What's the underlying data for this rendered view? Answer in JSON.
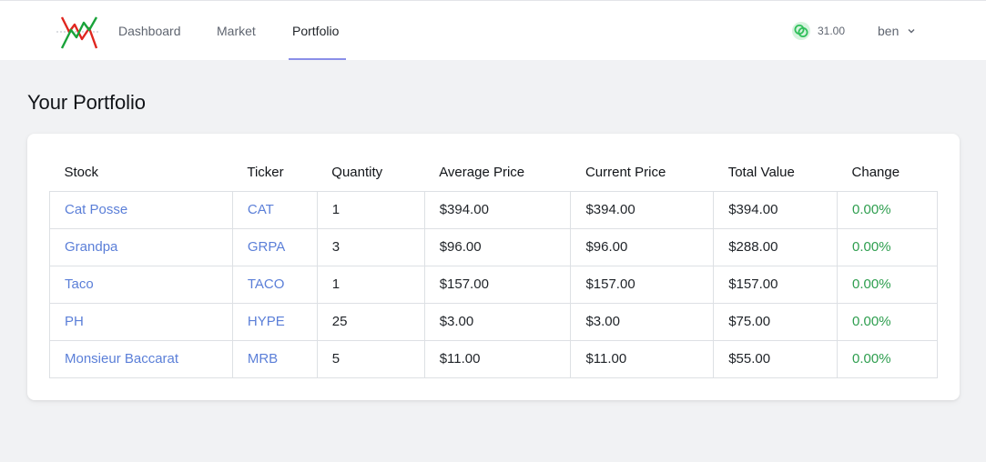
{
  "nav": {
    "items": [
      {
        "label": "Dashboard",
        "active": false
      },
      {
        "label": "Market",
        "active": false
      },
      {
        "label": "Portfolio",
        "active": true
      }
    ],
    "balance": "31.00",
    "user": "ben",
    "accent": "#8a8fe8"
  },
  "page": {
    "title": "Your Portfolio"
  },
  "table": {
    "headers": [
      "Stock",
      "Ticker",
      "Quantity",
      "Average Price",
      "Current Price",
      "Total Value",
      "Change"
    ],
    "rows": [
      {
        "stock": "Cat Posse",
        "ticker": "CAT",
        "quantity": "1",
        "avg": "$394.00",
        "current": "$394.00",
        "total": "$394.00",
        "change": "0.00%"
      },
      {
        "stock": "Grandpa",
        "ticker": "GRPA",
        "quantity": "3",
        "avg": "$96.00",
        "current": "$96.00",
        "total": "$288.00",
        "change": "0.00%"
      },
      {
        "stock": "Taco",
        "ticker": "TACO",
        "quantity": "1",
        "avg": "$157.00",
        "current": "$157.00",
        "total": "$157.00",
        "change": "0.00%"
      },
      {
        "stock": "PH",
        "ticker": "HYPE",
        "quantity": "25",
        "avg": "$3.00",
        "current": "$3.00",
        "total": "$75.00",
        "change": "0.00%"
      },
      {
        "stock": "Monsieur Baccarat",
        "ticker": "MRB",
        "quantity": "5",
        "avg": "$11.00",
        "current": "$11.00",
        "total": "$55.00",
        "change": "0.00%"
      }
    ]
  },
  "colors": {
    "link": "#5b7fd8",
    "positive": "#2e9e4f",
    "logo_up": "#1aa33a",
    "logo_down": "#e0261f"
  }
}
